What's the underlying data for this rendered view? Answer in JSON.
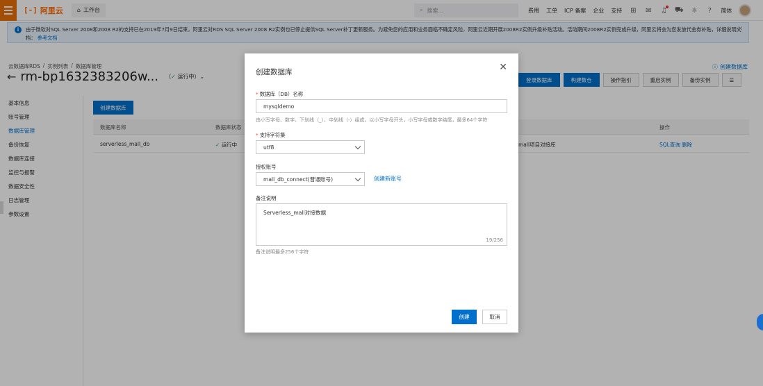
{
  "topbar": {
    "logo_text": "阿里云",
    "logo_mark": "[-]",
    "workbench": "工作台",
    "search_placeholder": "搜索...",
    "nav": [
      "费用",
      "工单",
      "ICP 备案",
      "企业",
      "支持"
    ],
    "language": "简体"
  },
  "notice": {
    "text": "由于微软对SQL Server 2008和2008 R2的支持已在2019年7月9日结束，阿里云对RDS SQL Server 2008 R2实例也已停止提供SQL Server补丁更新服务。为避免您的应用和业务面临不确定风险，阿里云近期开展2008R2实例升级补贴活动。活动期间2008R2实例完成升级，阿里云将会为您发放代金券补贴，详细说明文档：",
    "link": "参考文档"
  },
  "header": {
    "breadcrumb": [
      "云数据库RDS",
      "/",
      "实例列表",
      "/",
      "数据库管理"
    ],
    "title": "rm-bp1632383206w...",
    "status": "运行中",
    "create_db_link": "创建数据库",
    "toolbar": [
      "登录数据库",
      "构建数仓",
      "操作指引",
      "重启实例",
      "备份实例"
    ]
  },
  "sidebar": {
    "items": [
      "基本信息",
      "账号管理",
      "数据库管理",
      "备份恢复",
      "数据库连接",
      "监控与报警",
      "数据安全性",
      "日志管理",
      "参数设置"
    ]
  },
  "main": {
    "create_button": "创建数据库",
    "columns": [
      "数据库名称",
      "数据库状态",
      "操作"
    ],
    "rows": [
      {
        "name": "serverless_mall_db",
        "status": "运行中",
        "desc_tail": "mall项目对接库",
        "actions": [
          "SQL查询",
          "删除"
        ]
      }
    ]
  },
  "dialog": {
    "title": "创建数据库",
    "db_name_label": "数据库（DB）名称",
    "db_name_value": "mysqldemo",
    "db_name_hint": "由小写字母、数字、下划线（_）、中划线（-）组成，以小写字母开头，小写字母或数字结尾，最多64个字符",
    "charset_label": "支持字符集",
    "charset_value": "utf8",
    "account_label": "授权账号",
    "account_value": "mall_db_connect(普通账号)",
    "new_account_link": "创建新账号",
    "remark_label": "备注说明",
    "remark_value": "Serverless_mall对接数据",
    "remark_counter": "19/256",
    "remark_hint": "备注说明最多256个字符",
    "ok_button": "创建",
    "cancel_button": "取消"
  },
  "colors": {
    "brand": "#ff6a00",
    "primary": "#0070cc",
    "success": "#13a85b"
  }
}
